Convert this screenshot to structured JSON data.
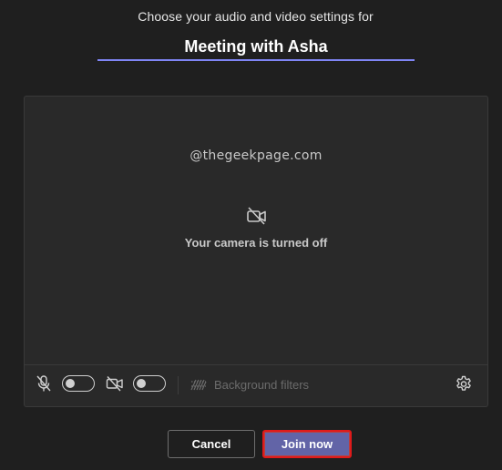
{
  "header": {
    "subtitle": "Choose your audio and video settings for",
    "meeting_title": "Meeting with Asha"
  },
  "preview": {
    "watermark": "@thegeekpage.com",
    "camera_status_icon": "video-off-icon",
    "camera_status_text": "Your camera is turned off"
  },
  "controls": {
    "mic_icon": "mic-off-icon",
    "mic_toggle_on": false,
    "video_icon": "video-off-icon",
    "video_toggle_on": false,
    "background_filters_label": "Background filters",
    "background_filters_icon": "background-blur-icon",
    "settings_icon": "gear-icon"
  },
  "actions": {
    "cancel_label": "Cancel",
    "join_label": "Join now"
  },
  "colors": {
    "background": "#1f1f1f",
    "panel": "#292929",
    "accent": "#6264a7",
    "underline": "#7f85f5",
    "highlight_border": "#e01a1a"
  }
}
